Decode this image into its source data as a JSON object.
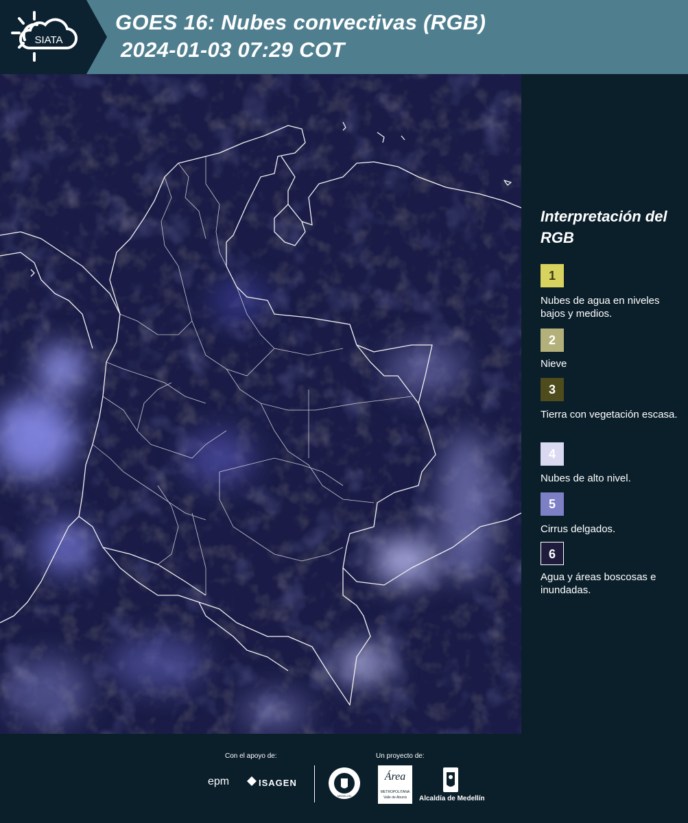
{
  "header": {
    "logo_text": "SIATA",
    "title_line1": "GOES 16: Nubes convectivas (RGB)",
    "title_line2": "2024-01-03 07:29 COT"
  },
  "legend": {
    "title": "Interpretación del RGB",
    "items": [
      {
        "number": "1",
        "label": "Nubes de agua en niveles bajos y medios.",
        "color": "#d8d35e",
        "text_color": "#3a3a1a"
      },
      {
        "number": "2",
        "label": "Nieve",
        "color": "#b3b07a",
        "text_color": "#ffffff"
      },
      {
        "number": "3",
        "label": "Tierra con vegetación escasa.",
        "color": "#4e4b1c",
        "text_color": "#ffffff"
      },
      {
        "number": "4",
        "label": "Nubes de alto nivel.",
        "color": "#d9d9f2",
        "text_color": "#ffffff"
      },
      {
        "number": "5",
        "label": "Cirrus delgados.",
        "color": "#7e80c6",
        "text_color": "#ffffff"
      },
      {
        "number": "6",
        "label": "Agua y áreas boscosas e inundadas.",
        "color": "#1e1b3c",
        "text_color": "#ffffff"
      }
    ]
  },
  "footer": {
    "support_label": "Con el apoyo de:",
    "project_label": "Un proyecto de:",
    "epm": "epm",
    "isagen": "ISAGEN",
    "area_name": "Área",
    "area_sub1": "METROPOLITANA",
    "area_sub2": "Valle de Aburrá",
    "alcaldia": "Alcaldía de Medellín",
    "medellin_seal_text": "MEDELLÍN"
  },
  "colors": {
    "header_bg": "#4f7f8f",
    "logo_bg": "#0c2230",
    "panel_bg": "#0b1f2b",
    "map_bg": "#181b48"
  }
}
